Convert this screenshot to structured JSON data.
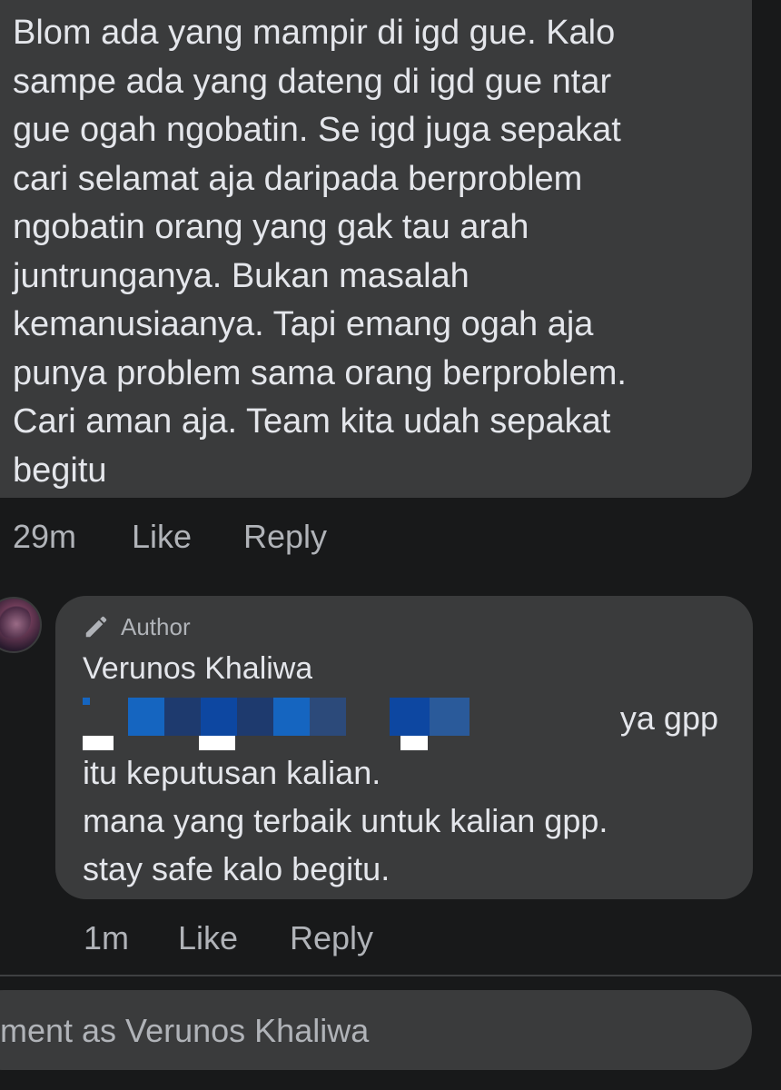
{
  "comment": {
    "text": "Blom ada yang mampir di igd gue. Kalo\nsampe ada yang dateng di igd gue ntar\ngue ogah ngobatin. Se igd juga sepakat\ncari selamat aja daripada berproblem\nngobatin orang yang gak tau arah\njuntrunganya. Bukan masalah\nkemanusiaanya. Tapi emang ogah aja\npunya problem sama orang berproblem.\nCari aman aja. Team kita udah sepakat\nbegitu",
    "time": "29m",
    "like_label": "Like",
    "reply_label": "Reply"
  },
  "reply": {
    "author_badge": "Author",
    "author_icon": "pencil-icon",
    "name": "Verunos Khaliwa",
    "first_line_end": "ya gpp",
    "lines": [
      "itu keputusan kalian.",
      "mana yang terbaik untuk kalian gpp.",
      "stay safe kalo begitu."
    ],
    "time": "1m",
    "like_label": "Like",
    "reply_label": "Reply",
    "redaction_colors": [
      "#1565c0",
      "#0d47a1",
      "#1e88e5",
      "#1e3a6e",
      "#2c4a7a",
      "#1565c0"
    ]
  },
  "composer": {
    "placeholder": "ment as Verunos Khaliwa"
  }
}
